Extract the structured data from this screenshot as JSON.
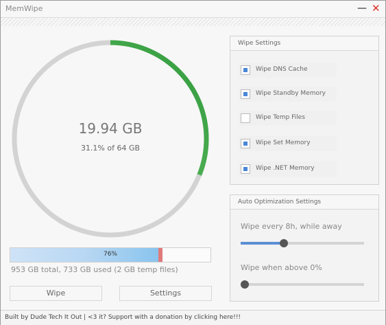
{
  "window": {
    "title": "MemWipe",
    "minimize_symbol": "—",
    "close_symbol": "✕"
  },
  "memory": {
    "used_display": "19.94 GB",
    "percent_display": "31.1% of 64 GB",
    "used_fraction": 0.311
  },
  "disk": {
    "bar_label": "76%",
    "used_fraction": 0.76,
    "temp_fraction": 0.02,
    "info": "953 GB total, 733 GB used (2 GB temp files)"
  },
  "buttons": {
    "wipe": "Wipe",
    "settings": "Settings"
  },
  "wipe_settings": {
    "title": "Wipe Settings",
    "options": [
      {
        "label": "Wipe DNS Cache",
        "checked": true
      },
      {
        "label": "Wipe Standby Memory",
        "checked": true
      },
      {
        "label": "Wipe Temp Files",
        "checked": false
      },
      {
        "label": "Wipe Set Memory",
        "checked": true
      },
      {
        "label": "Wipe .NET Memory",
        "checked": true
      }
    ]
  },
  "auto_optimization": {
    "title": "Auto Optimization Settings",
    "sliders": [
      {
        "label": "Wipe every 8h, while away",
        "value": 0.35
      },
      {
        "label": "Wipe when above 0%",
        "value": 0.0
      }
    ]
  },
  "colors": {
    "ring_track": "#d3d3d3",
    "ring_fill_start": "#7dcf7a",
    "ring_fill_end": "#2f9a3b",
    "accent": "#4a86d8",
    "close": "#d9322a"
  },
  "status": {
    "text": "Built by Dude Tech It Out | <3 it? Support with a donation by clicking here!!!"
  }
}
